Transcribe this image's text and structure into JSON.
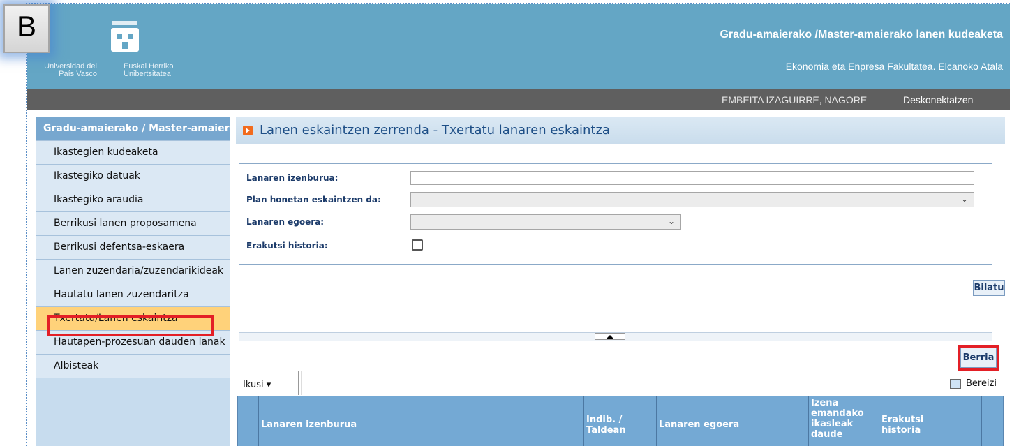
{
  "header": {
    "title": "Gradu-amaierako /Master-amaierako lanen kudeaketa",
    "subtitle": "Ekonomia eta Enpresa Fakultatea. Elcanoko Atala",
    "logo_left_text": "Universidad del País Vasco",
    "logo_right_text": "Euskal Herriko Unibertsitatea",
    "color": "#64a6c5"
  },
  "userbar": {
    "user": "EMBEITA IZAGUIRRE, NAGORE",
    "logout": "Deskonektatzen"
  },
  "sidebar": {
    "header": "Gradu-amaierako / Master-amaierako",
    "items": [
      {
        "label": "Ikastegien kudeaketa"
      },
      {
        "label": "Ikastegiko datuak"
      },
      {
        "label": "Ikastegiko araudia"
      },
      {
        "label": "Berrikusi lanen proposamena"
      },
      {
        "label": "Berrikusi defentsa-eskaera"
      },
      {
        "label": "Lanen zuzendaria/zuzendarikideak"
      },
      {
        "label": "Hautatu lanen zuzendaritza"
      },
      {
        "label": "Txertatu/Lanen eskaintza",
        "active": true
      },
      {
        "label": "Hautapen-prozesuan dauden lanak"
      },
      {
        "label": "Albisteak"
      }
    ]
  },
  "content": {
    "title": "Lanen eskaintzen zerrenda - Txertatu lanaren eskaintza",
    "form": {
      "title_label": "Lanaren izenburua:",
      "title_value": "",
      "plan_label": "Plan honetan eskaintzen da:",
      "plan_value": "",
      "state_label": "Lanaren egoera:",
      "state_value": "",
      "history_label": "Erakutsi historia:",
      "history_checked": false
    },
    "search_button": "Bilatu",
    "new_button": "Berria",
    "toolbar": {
      "view": "Ikusi",
      "detach": "Bereizi"
    },
    "columns": [
      {
        "label": ""
      },
      {
        "label": "Lanaren izenburua"
      },
      {
        "label": "Indib. / Taldean"
      },
      {
        "label": "Lanaren egoera"
      },
      {
        "label": "Izena emandako ikasleak daude"
      },
      {
        "label": "Erakutsi historia"
      },
      {
        "label": ""
      }
    ]
  },
  "overlay": {
    "badge": "B"
  },
  "colors": {
    "highlight": "#e31f26",
    "active_item": "#ffd27a",
    "grid_header": "#74a9d4"
  }
}
